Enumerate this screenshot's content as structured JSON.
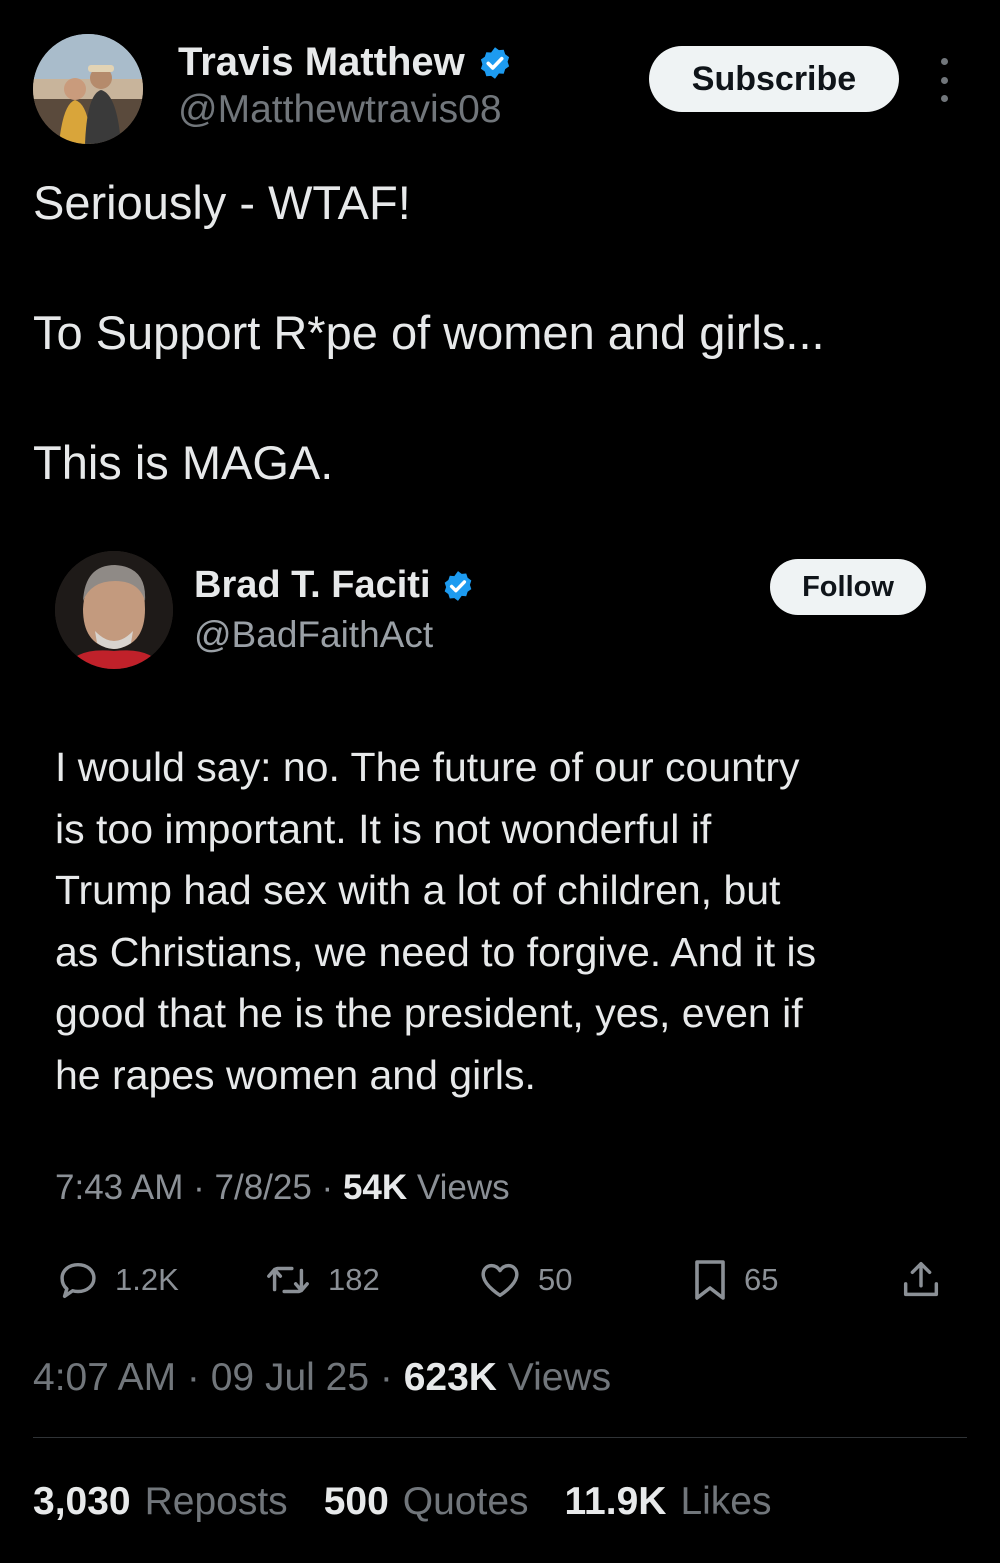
{
  "author": {
    "name": "Travis Matthew",
    "handle": "@Matthewtravis08",
    "verified_icon": "verified-badge-icon",
    "verified_color": "#1d9bf0"
  },
  "header": {
    "subscribe_label": "Subscribe",
    "more_icon": "more-vertical-icon"
  },
  "tweet": {
    "lines": [
      "Seriously - WTAF!",
      "To Support R*pe of women and girls...",
      "This is MAGA."
    ]
  },
  "quoted": {
    "name": "Brad T. Faciti",
    "handle": "@BadFaithAct",
    "follow_label": "Follow",
    "body_lines": [
      "I would say: no. The future of our country",
      "is too important. It is not wonderful if",
      "Trump had sex with a lot of children, but",
      "as Christians, we need to forgive. And it is",
      "good that he is the president, yes, even if",
      "he rapes women and girls."
    ],
    "time": "7:43 AM · 7/8/25 · ",
    "views_count": "54K",
    "views_label": " Views",
    "actions": {
      "replies": "1.2K",
      "reposts": "182",
      "likes": "50",
      "bookmarks": "65"
    }
  },
  "meta": {
    "time": "4:07 AM · 09 Jul 25 · ",
    "views_count": "623K",
    "views_label": " Views"
  },
  "stats": {
    "reposts_count": "3,030",
    "reposts_label": "Reposts",
    "quotes_count": "500",
    "quotes_label": "Quotes",
    "likes_count": "11.9K",
    "likes_label": "Likes"
  }
}
